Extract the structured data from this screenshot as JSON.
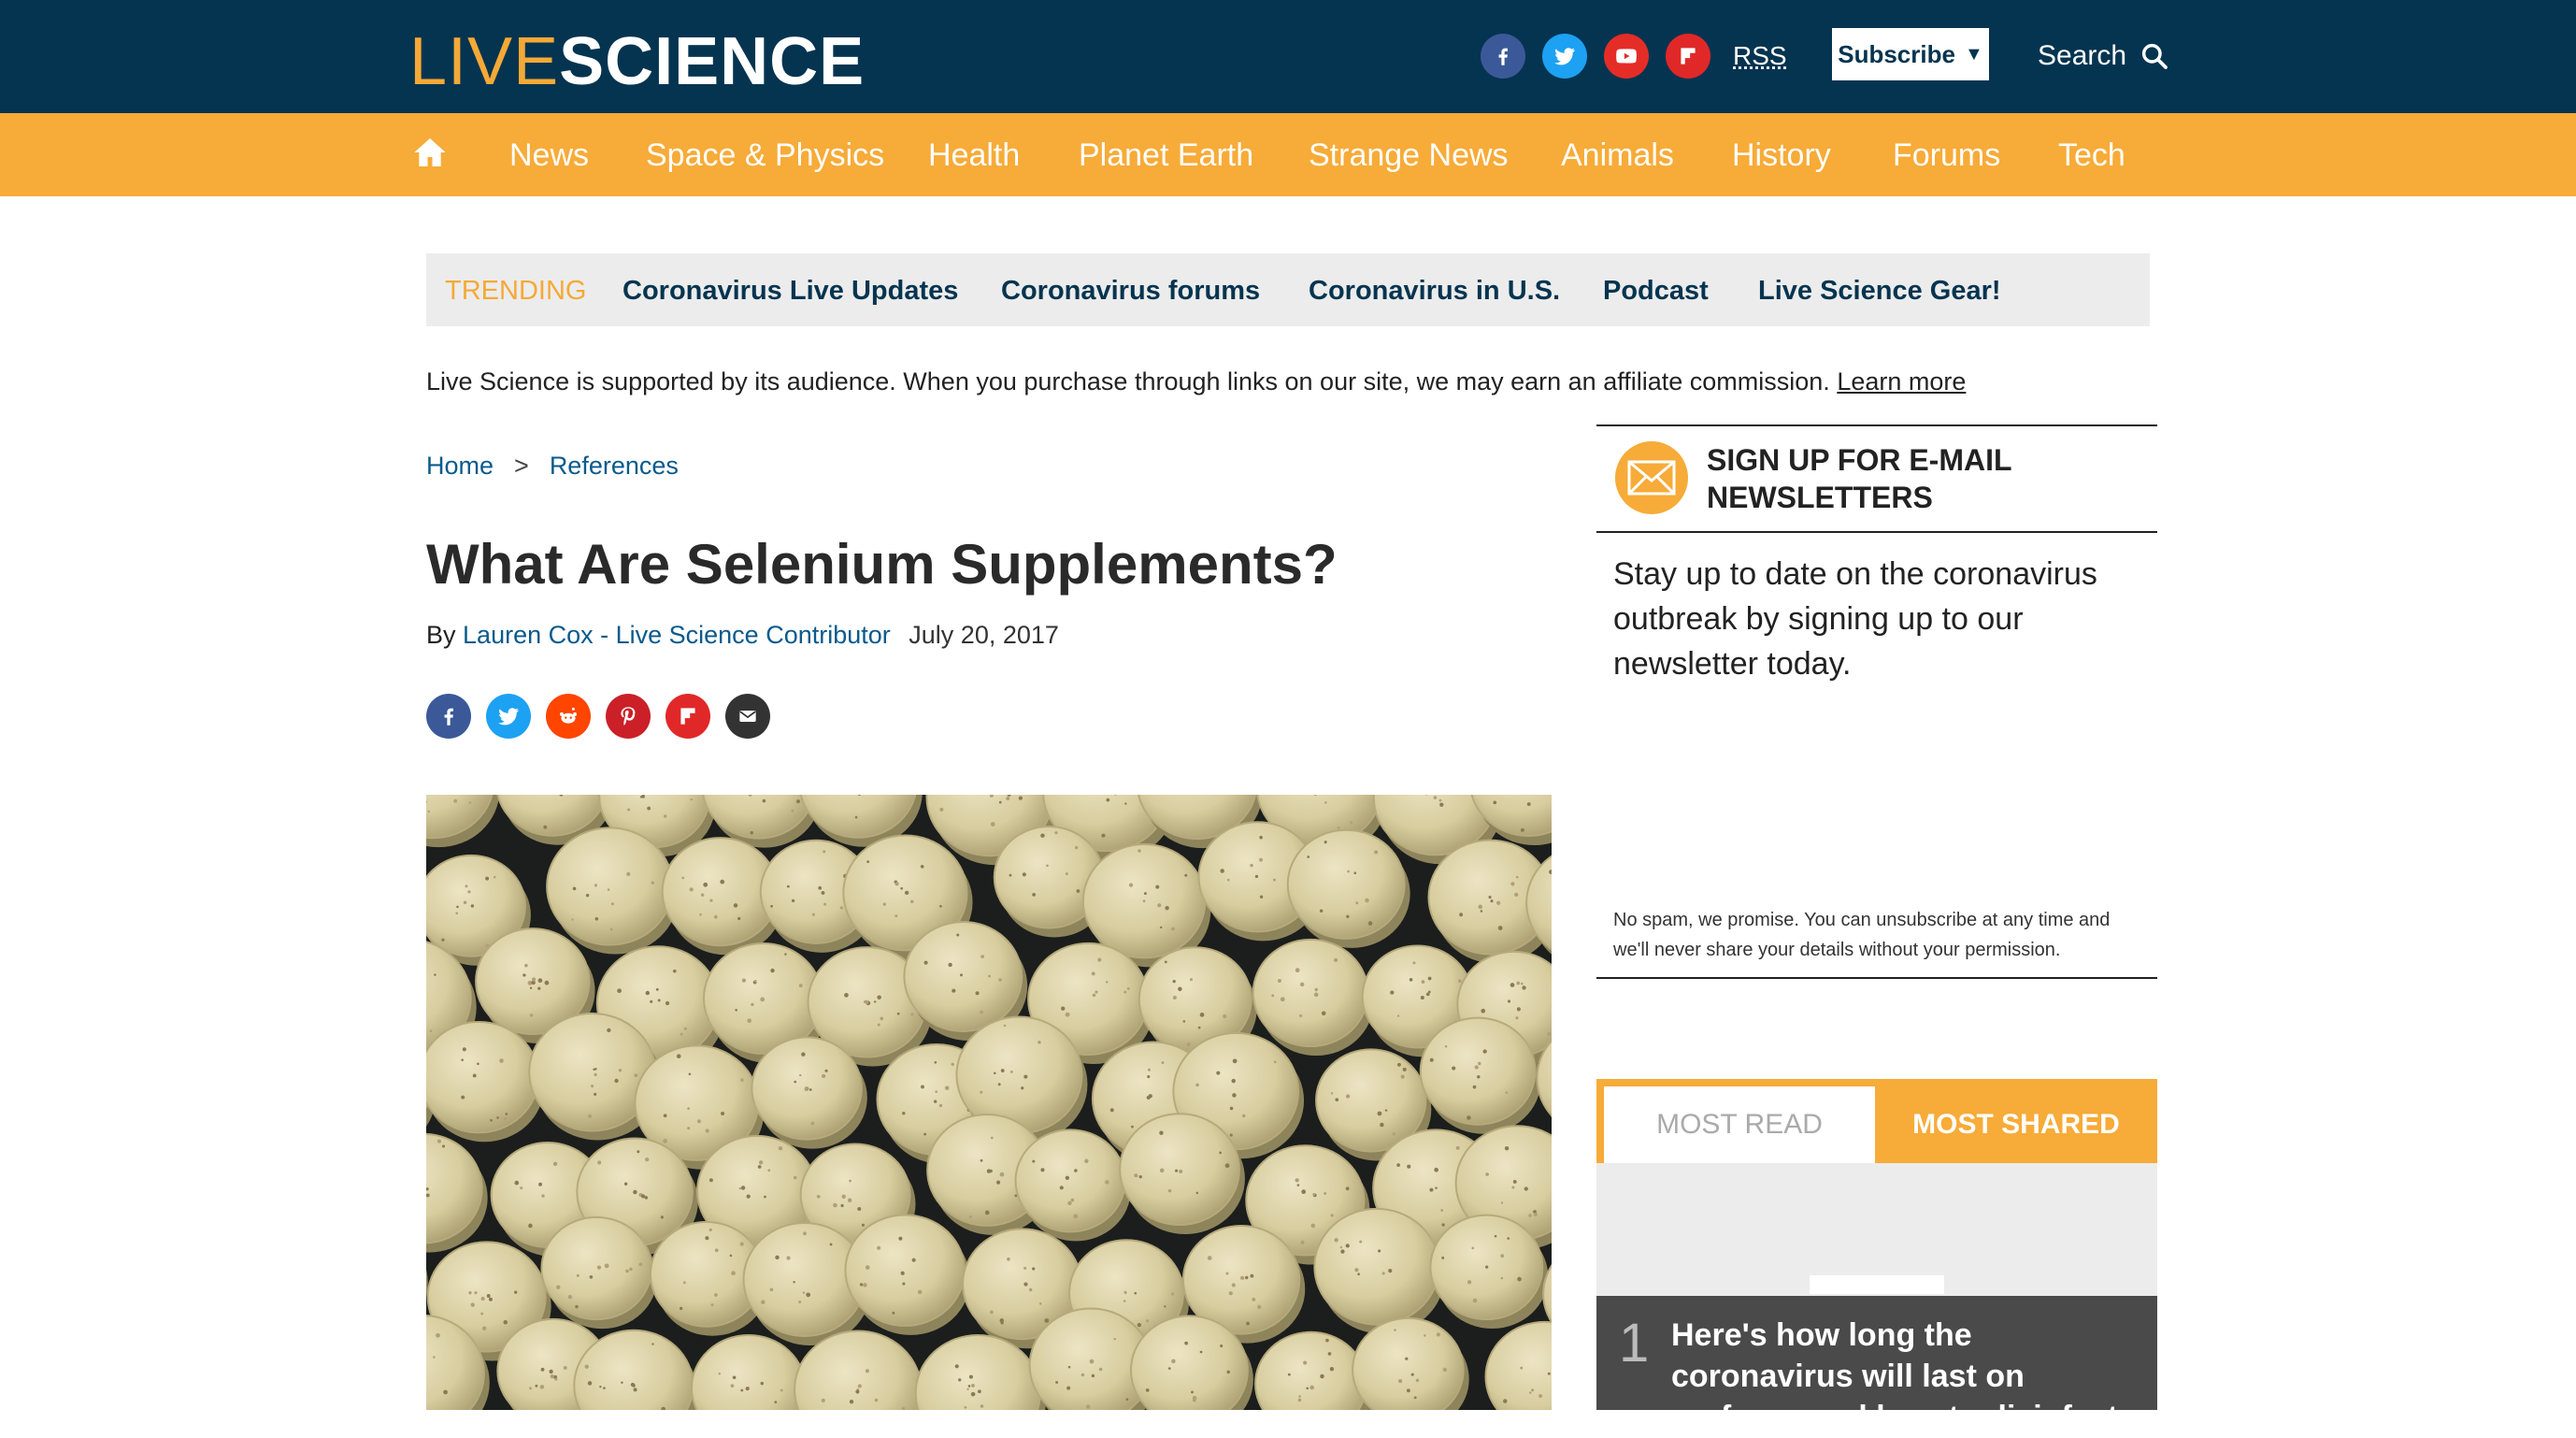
{
  "header": {
    "logo": {
      "live": "LIVE",
      "science": "SCIENCE"
    },
    "social": [
      {
        "name": "facebook-icon",
        "color": "#3b5998"
      },
      {
        "name": "twitter-icon",
        "color": "#1da1f2"
      },
      {
        "name": "youtube-icon",
        "color": "#e52d27"
      },
      {
        "name": "flipboard-icon",
        "color": "#e12828"
      }
    ],
    "rss": "RSS",
    "subscribe": "Subscribe",
    "search": "Search"
  },
  "nav": {
    "items": [
      "News",
      "Space & Physics",
      "Health",
      "Planet Earth",
      "Strange News",
      "Animals",
      "History",
      "Forums",
      "Tech"
    ]
  },
  "trending": {
    "label": "TRENDING",
    "items": [
      "Coronavirus Live Updates",
      "Coronavirus forums",
      "Coronavirus in U.S.",
      "Podcast",
      "Live Science Gear!"
    ]
  },
  "affiliate": {
    "text": "Live Science is supported by its audience. When you purchase through links on our site, we may earn an affiliate commission.",
    "link": "Learn more"
  },
  "breadcrumb": {
    "home": "Home",
    "sep": ">",
    "section": "References"
  },
  "article": {
    "title": "What Are Selenium Supplements?",
    "by": "By",
    "author": "Lauren Cox - Live Science Contributor",
    "date": "July 20, 2017",
    "share": [
      "facebook-icon",
      "twitter-icon",
      "reddit-icon",
      "pinterest-icon",
      "flipboard-icon",
      "email-icon"
    ]
  },
  "newsletter": {
    "title": "SIGN UP FOR E-MAIL NEWSLETTERS",
    "body": "Stay up to date on the coronavirus outbreak by signing up to our newsletter today.",
    "fine": "No spam, we promise. You can unsubscribe at any time and we'll never share your details without your permission."
  },
  "popular": {
    "tab_read": "MOST READ",
    "tab_shared": "MOST SHARED",
    "items": [
      {
        "rank": "1",
        "title": "Here's how long the coronavirus will last on surfaces and how to disinfect"
      }
    ]
  },
  "colors": {
    "header_bg": "#053450",
    "accent": "#f7ab38",
    "link": "#0a5a8c"
  }
}
